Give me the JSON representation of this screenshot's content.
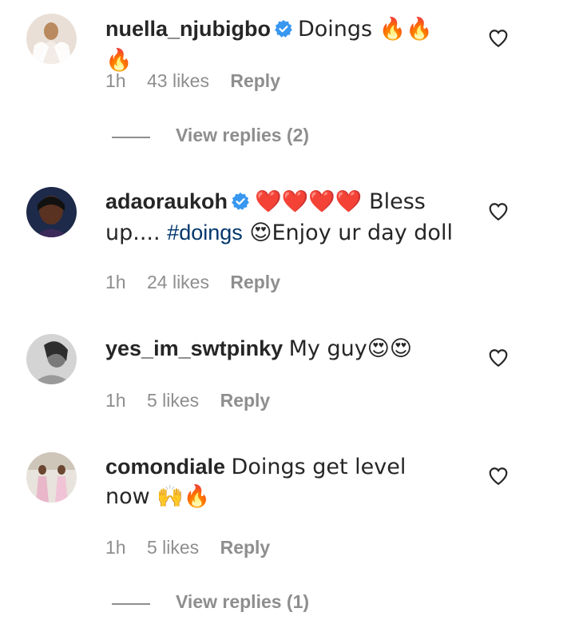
{
  "comments": [
    {
      "username": "nuella_njubigbo",
      "verified": true,
      "text": "Doings 🔥🔥🔥",
      "time": "1h",
      "likes": "43 likes",
      "reply": "Reply",
      "view_replies": "View replies (2)"
    },
    {
      "username": "adaoraukoh",
      "verified": true,
      "text_pre": "❤️❤️❤️❤️ Bless up.... ",
      "hashtag": "#doings",
      "text_post": " 😍Enjoy ur day doll",
      "time": "1h",
      "likes": "24 likes",
      "reply": "Reply"
    },
    {
      "username": "yes_im_swtpinky",
      "verified": false,
      "text": "My guy😍😍",
      "time": "1h",
      "likes": "5 likes",
      "reply": "Reply"
    },
    {
      "username": "comondiale",
      "verified": false,
      "text": "Doings get level now 🙌🔥",
      "time": "1h",
      "likes": "5 likes",
      "reply": "Reply",
      "view_replies": "View replies (1)"
    }
  ],
  "colors": {
    "text": "#262626",
    "secondary": "#8e8e8e",
    "hashtag": "#00376b",
    "verified": "#3897f0"
  },
  "icons": {
    "like": "heart-outline-icon",
    "verified": "verified-badge-icon"
  }
}
